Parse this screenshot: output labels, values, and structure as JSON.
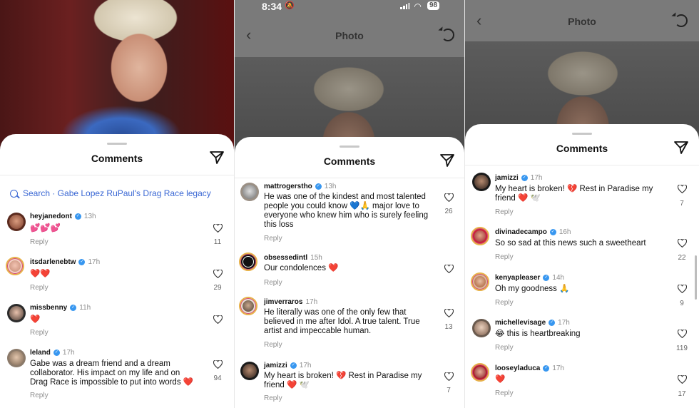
{
  "status": {
    "time": "8:34",
    "bell": "🔕",
    "battery": "98"
  },
  "nav": {
    "title": "Photo",
    "back": "‹"
  },
  "sheet_title": "Comments",
  "search": {
    "text": "Search · Gabe Lopez RuPaul's Drag Race legacy"
  },
  "reply_label": "Reply",
  "colors": {
    "accent": "#3b68d4",
    "verified": "#3897f0",
    "heart": "#e0245e"
  },
  "panel1": {
    "comments": [
      {
        "user": "heyjanedont",
        "age": "13h",
        "text": "💕💕💕",
        "likes": "11"
      },
      {
        "user": "itsdarlenebtw",
        "age": "17h",
        "text": "❤️❤️",
        "likes": "29"
      },
      {
        "user": "missbenny",
        "age": "11h",
        "text": "❤️",
        "likes": ""
      },
      {
        "user": "leland",
        "age": "17h",
        "text1": "Gabe was a dream friend and a dream",
        "text2": "collaborator.  His impact on my life and on",
        "text3": "Drag Race is impossible to put into words ❤️",
        "likes": "94"
      }
    ]
  },
  "panel2": {
    "comments": [
      {
        "user": "mattrogerstho",
        "age": "13h",
        "text1": "He was one of the kindest and most talented",
        "text2": "people you could know 💙🙏 major love to",
        "text3": "everyone who knew him who is surely feeling",
        "text4": "this loss",
        "likes": "26"
      },
      {
        "user": "obsessedintl",
        "age": "15h",
        "text": "Our condolences ❤️",
        "likes": ""
      },
      {
        "user": "jimverraros",
        "age": "17h",
        "text1": "He literally was one of the only few that",
        "text2": "believed in me after Idol. A true talent. True",
        "text3": "artist and impeccable human.",
        "likes": "13"
      },
      {
        "user": "jamizzi",
        "age": "17h",
        "text1": "My heart is broken! 💔 Rest in Paradise my",
        "text2": "friend ❤️ 🕊️",
        "likes": "7"
      }
    ]
  },
  "panel3": {
    "comments": [
      {
        "user": "jamizzi",
        "age": "17h",
        "text1": "My heart is broken! 💔 Rest in Paradise my",
        "text2": "friend ❤️ 🕊️",
        "likes": "7"
      },
      {
        "user": "divinadecampo",
        "age": "16h",
        "text": "So so sad at this news such a sweetheart",
        "likes": "22"
      },
      {
        "user": "kenyapleaser",
        "age": "14h",
        "text": "Oh my goodness 🙏",
        "likes": "9"
      },
      {
        "user": "michellevisage",
        "age": "17h",
        "text": "😂 this is heartbreaking",
        "likes": "119"
      },
      {
        "user": "looseyladuca",
        "age": "17h",
        "text": "❤️",
        "likes": "17"
      }
    ]
  }
}
